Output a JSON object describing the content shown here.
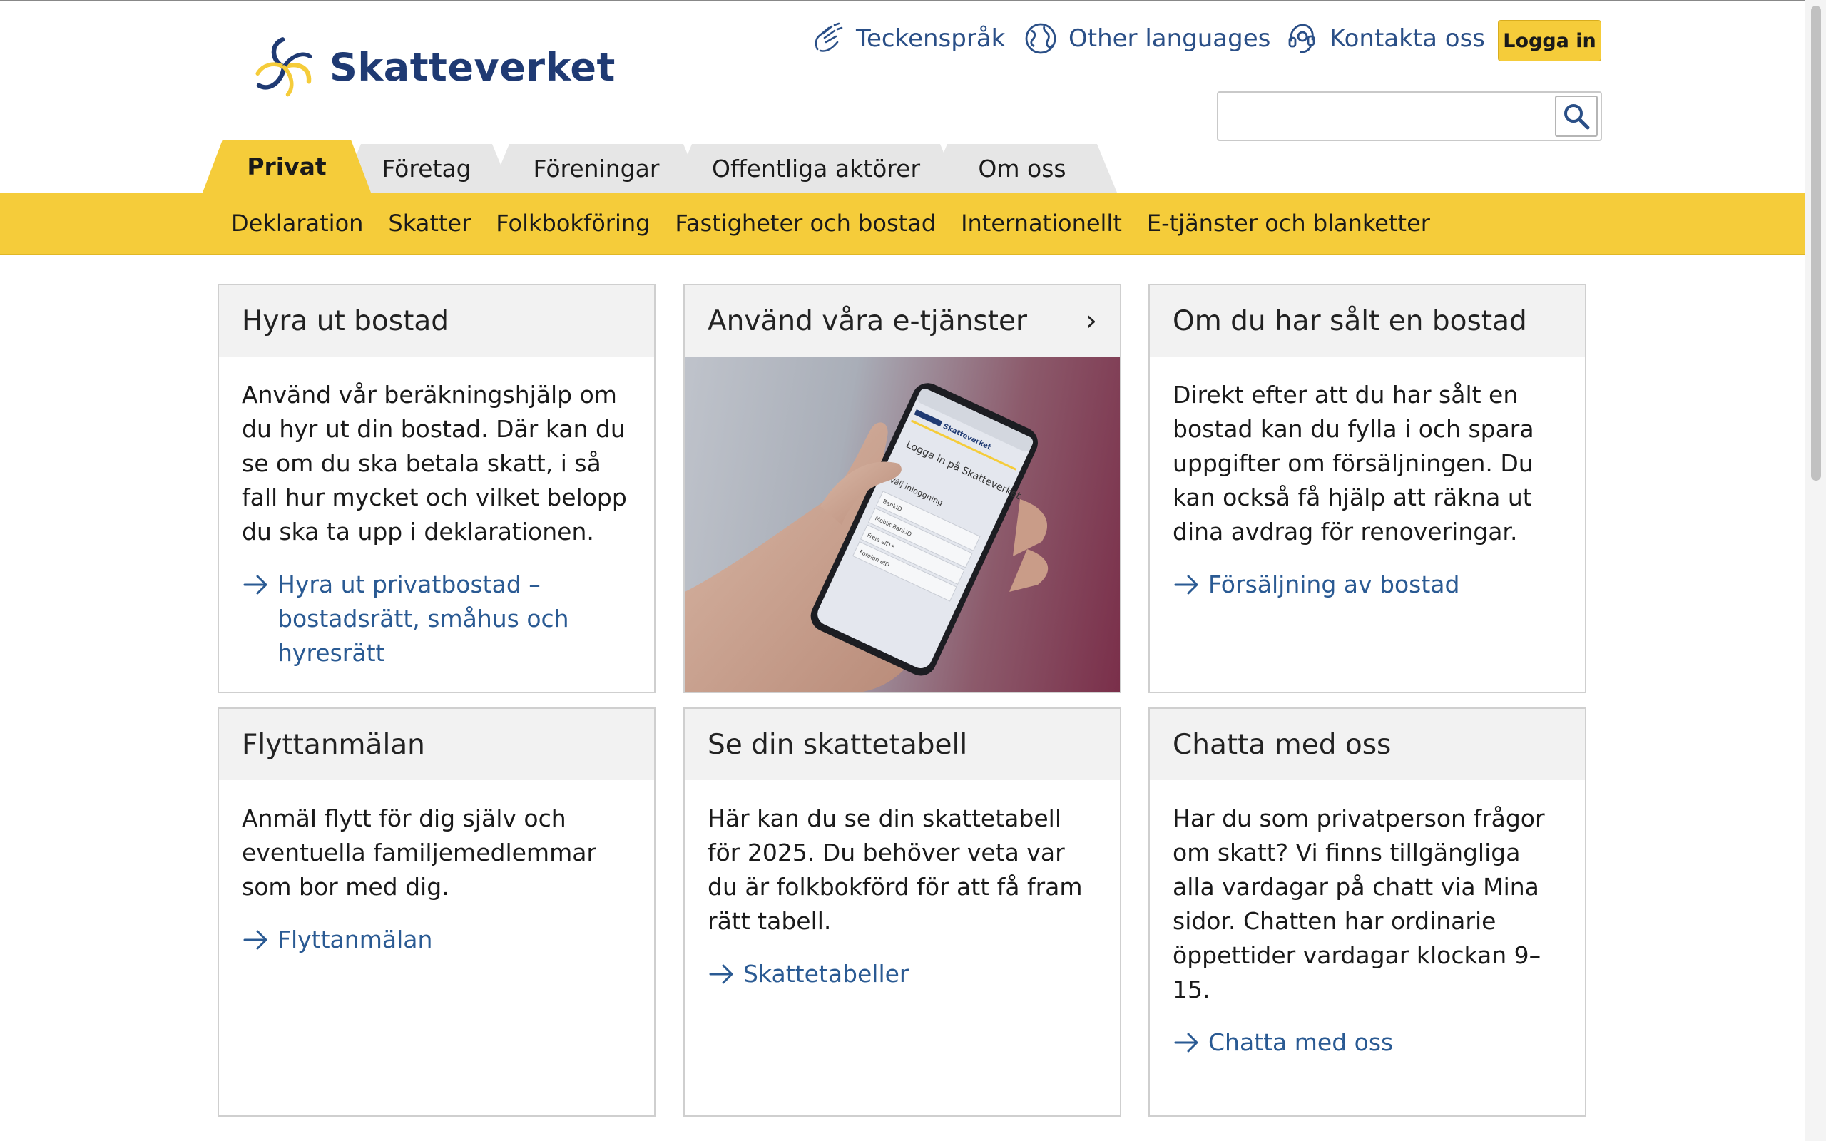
{
  "brand": {
    "name": "Skatteverket",
    "navy": "#1f3a73",
    "yellow": "#f5cc3a",
    "link": "#2a5a93"
  },
  "toplinks": {
    "sign_language": "Teckenspråk",
    "other_languages": "Other languages",
    "contact": "Kontakta oss",
    "login": "Logga in"
  },
  "search": {
    "value": "",
    "placeholder": "",
    "icon": "search-icon"
  },
  "tabs": [
    {
      "label": "Privat",
      "active": true
    },
    {
      "label": "Företag",
      "active": false
    },
    {
      "label": "Föreningar",
      "active": false
    },
    {
      "label": "Offentliga aktörer",
      "active": false
    },
    {
      "label": "Om oss",
      "active": false
    }
  ],
  "subnav": [
    "Deklaration",
    "Skatter",
    "Folkbokföring",
    "Fastigheter och bostad",
    "Internationellt",
    "E-tjänster och blanketter"
  ],
  "cards": [
    {
      "title": "Hyra ut bostad",
      "text": "Använd vår beräkningshjälp om du hyr ut din bostad. Där kan du se om du ska betala skatt, i så fall hur mycket och vilket belopp du ska ta upp i deklarationen.",
      "link": "Hyra ut privatbostad – bostadsrätt, småhus och hyresrätt"
    },
    {
      "title": "Använd våra e-tjänster",
      "phone": {
        "title": "Logga in på Skatteverket",
        "choose": "Välj inloggning",
        "options": [
          "BankID",
          "Mobilt BankID",
          "Freja eID+",
          "Foreign eID"
        ]
      }
    },
    {
      "title": "Om du har sålt en bostad",
      "text": "Direkt efter att du har sålt en bostad kan du fylla i och spara uppgifter om försäljningen. Du kan också få hjälp att räkna ut dina avdrag för renoveringar.",
      "link": "Försäljning av bostad"
    },
    {
      "title": "Flyttanmälan",
      "text": "Anmäl flytt för dig själv och eventuella familjemedlemmar som bor med dig.",
      "link": "Flyttanmälan"
    },
    {
      "title": "Se din skattetabell",
      "text": "Här kan du se din skattetabell för 2025. Du behöver veta var du är folkbokförd för att få fram rätt tabell.",
      "link": "Skattetabeller"
    },
    {
      "title": "Chatta med oss",
      "text": "Har du som privatperson frågor om skatt? Vi finns tillgängliga alla vardagar på chatt via Mina sidor. Chatten har ordinarie öppettider vardagar klockan 9–15.",
      "link": "Chatta med oss"
    }
  ]
}
